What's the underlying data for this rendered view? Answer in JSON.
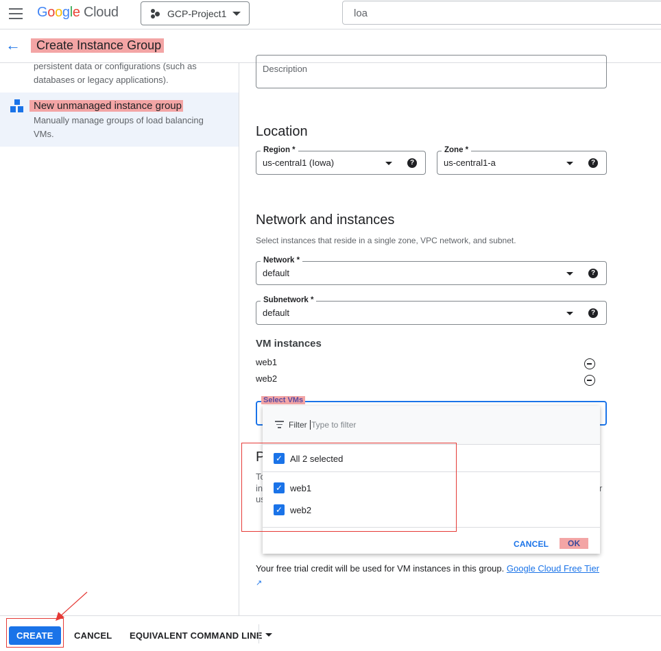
{
  "header": {
    "logo": "Google Cloud",
    "project": "GCP-Project1",
    "search_value": "loa"
  },
  "title_bar": {
    "title": "Create Instance Group"
  },
  "sidebar": {
    "prev_desc_1": "persistent data or configurations (such as",
    "prev_desc_2": "databases or legacy applications).",
    "item_title": "New unmanaged instance group",
    "item_desc_1": "Manually manage groups of load balancing",
    "item_desc_2": "VMs."
  },
  "form": {
    "description_placeholder": "Description",
    "location_heading": "Location",
    "region": {
      "label": "Region *",
      "value": "us-central1 (Iowa)"
    },
    "zone": {
      "label": "Zone *",
      "value": "us-central1-a"
    },
    "network_heading": "Network and instances",
    "network_desc": "Select instances that reside in a single zone, VPC network, and subnet.",
    "network": {
      "label": "Network *",
      "value": "default"
    },
    "subnetwork": {
      "label": "Subnetwork *",
      "value": "default"
    },
    "vm_heading": "VM instances",
    "vms": [
      "web1",
      "web2"
    ],
    "select_label": "Select VMs",
    "bg_fragments": {
      "heading": "P",
      "line1": "To",
      "line2": "in",
      "line3": "us",
      "right": "r"
    },
    "free_trial": "Your free trial credit will be used for VM instances in this group.",
    "free_tier_link": "Google Cloud Free Tier"
  },
  "dropdown": {
    "filter_label": "Filter",
    "filter_placeholder": "Type to filter",
    "select_all": "All 2 selected",
    "options": [
      {
        "label": "web1",
        "checked": true
      },
      {
        "label": "web2",
        "checked": true
      }
    ],
    "cancel": "CANCEL",
    "ok": "OK"
  },
  "footer": {
    "create": "CREATE",
    "cancel": "CANCEL",
    "command_line": "EQUIVALENT COMMAND LINE"
  },
  "colors": {
    "accent": "#1a73e8",
    "highlight": "#f3a5a5",
    "annotation": "#e53935"
  }
}
